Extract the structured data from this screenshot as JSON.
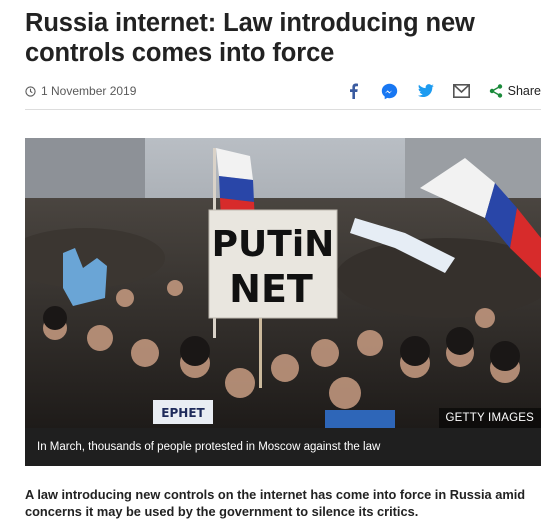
{
  "article": {
    "headline": "Russia internet: Law introducing new controls comes into force",
    "date": "1 November 2019",
    "share_label": "Share",
    "share_icons": [
      "facebook-icon",
      "messenger-icon",
      "twitter-icon",
      "email-icon",
      "share-icon"
    ],
    "image": {
      "sign_line1": "PUTiN",
      "sign_line2": "NET",
      "banner_text": "EPHET",
      "credit": "GETTY IMAGES",
      "caption": "In March, thousands of people protested in Moscow against the law"
    },
    "lead": "A law introducing new controls on the internet has come into force in Russia amid concerns it may be used by the government to silence its critics."
  },
  "colors": {
    "text": "#222222",
    "meta": "#5a5a5a",
    "accent_blue": "#3a5ba0",
    "share_green": "#1a8a3a",
    "caption_bg": "#1f1f1f"
  }
}
